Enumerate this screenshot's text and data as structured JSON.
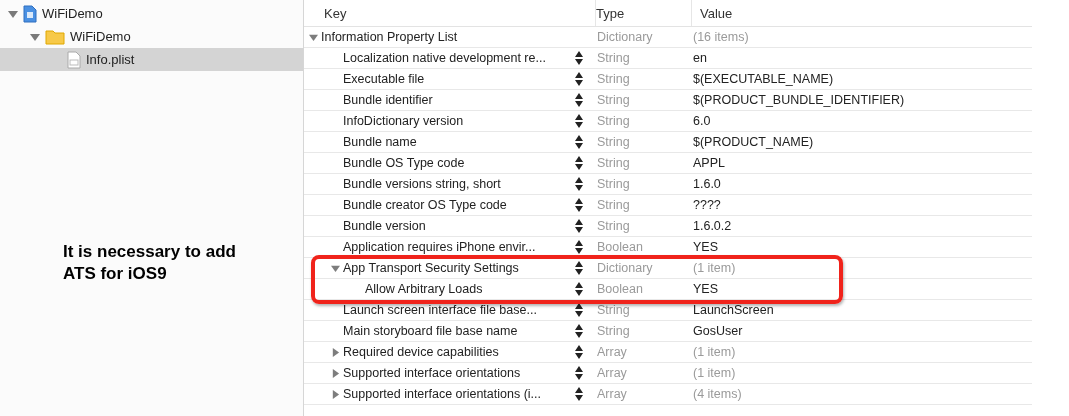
{
  "navigator": {
    "items": [
      {
        "label": "WiFiDemo",
        "kind": "project",
        "expanded": true,
        "selected": false,
        "children": [
          {
            "label": "WiFiDemo",
            "kind": "folder",
            "expanded": true,
            "selected": false,
            "children": [
              {
                "label": "Info.plist",
                "kind": "file",
                "selected": true
              }
            ]
          }
        ]
      }
    ]
  },
  "annotation": {
    "text": "It is necessary to add ATS for iOS9"
  },
  "plist": {
    "columns": [
      "Key",
      "Type",
      "Value"
    ],
    "root": {
      "key": "Information Property List",
      "type": "Dictionary",
      "value": "(16 items)",
      "kind": "container",
      "expanded": true,
      "children": [
        {
          "key": "Localization native development re...",
          "type": "String",
          "value": "en",
          "kind": "leaf"
        },
        {
          "key": "Executable file",
          "type": "String",
          "value": "$(EXECUTABLE_NAME)",
          "kind": "leaf"
        },
        {
          "key": "Bundle identifier",
          "type": "String",
          "value": "$(PRODUCT_BUNDLE_IDENTIFIER)",
          "kind": "leaf"
        },
        {
          "key": "InfoDictionary version",
          "type": "String",
          "value": "6.0",
          "kind": "leaf"
        },
        {
          "key": "Bundle name",
          "type": "String",
          "value": "$(PRODUCT_NAME)",
          "kind": "leaf"
        },
        {
          "key": "Bundle OS Type code",
          "type": "String",
          "value": "APPL",
          "kind": "leaf"
        },
        {
          "key": "Bundle versions string, short",
          "type": "String",
          "value": "1.6.0",
          "kind": "leaf"
        },
        {
          "key": "Bundle creator OS Type code",
          "type": "String",
          "value": "????",
          "kind": "leaf"
        },
        {
          "key": "Bundle version",
          "type": "String",
          "value": "1.6.0.2",
          "kind": "leaf"
        },
        {
          "key": "Application requires iPhone envir...",
          "type": "Boolean",
          "value": "YES",
          "kind": "leaf"
        },
        {
          "key": "App Transport Security Settings",
          "type": "Dictionary",
          "value": "(1 item)",
          "kind": "container",
          "expanded": true,
          "highlighted": true,
          "children": [
            {
              "key": "Allow Arbitrary Loads",
              "type": "Boolean",
              "value": "YES",
              "kind": "leaf",
              "highlighted": true
            }
          ]
        },
        {
          "key": "Launch screen interface file base...",
          "type": "String",
          "value": "LaunchScreen",
          "kind": "leaf"
        },
        {
          "key": "Main storyboard file base name",
          "type": "String",
          "value": "GosUser",
          "kind": "leaf"
        },
        {
          "key": "Required device capabilities",
          "type": "Array",
          "value": "(1 item)",
          "kind": "container",
          "expanded": false
        },
        {
          "key": "Supported interface orientations",
          "type": "Array",
          "value": "(1 item)",
          "kind": "container",
          "expanded": false
        },
        {
          "key": "Supported interface orientations (i...",
          "type": "Array",
          "value": "(4 items)",
          "kind": "container",
          "expanded": false
        }
      ]
    }
  }
}
